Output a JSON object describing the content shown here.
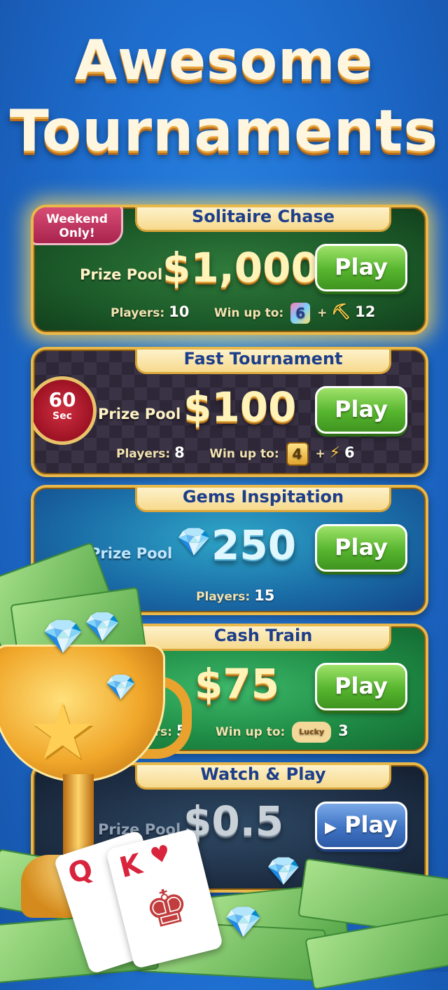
{
  "headline": {
    "line1": "Awesome",
    "line2": "Tournaments"
  },
  "colors": {
    "background": "#1f6fd0",
    "gold": "#e8b84a",
    "play_green": "#56b52e",
    "video_blue": "#3f74c4"
  },
  "tournaments": [
    {
      "name": "Solitaire Chase",
      "badge": "Weekend Only!",
      "prize_label": "Prize Pool",
      "prize": "$1,000",
      "play_label": "Play",
      "players_label": "Players:",
      "players": "10",
      "win_label": "Win up to:",
      "reward_1": "6",
      "reward_2": "12"
    },
    {
      "name": "Fast Tournament",
      "timer_value": "60",
      "timer_unit": "Sec",
      "prize_label": "Prize Pool",
      "prize": "$100",
      "play_label": "Play",
      "players_label": "Players:",
      "players": "8",
      "win_label": "Win up to:",
      "reward_1": "4",
      "reward_2": "6"
    },
    {
      "name": "Gems Inspitation",
      "prize_label": "Prize Pool",
      "prize": "250",
      "play_label": "Play",
      "players_label": "Players:",
      "players": "15"
    },
    {
      "name": "Cash Train",
      "prize": "$75",
      "play_label": "Play",
      "players_partial": "yers:",
      "players": "5",
      "win_label": "Win up to:",
      "reward_tag": "Lucky",
      "reward_1": "3"
    },
    {
      "name": "Watch & Play",
      "prize_label": "Prize Pool",
      "prize": "$0.5",
      "play_label": "Play"
    }
  ],
  "icons": [
    "gem-icon",
    "shovel-icon",
    "lightning-icon",
    "card-reward-icon",
    "video-icon",
    "trophy-icon"
  ]
}
